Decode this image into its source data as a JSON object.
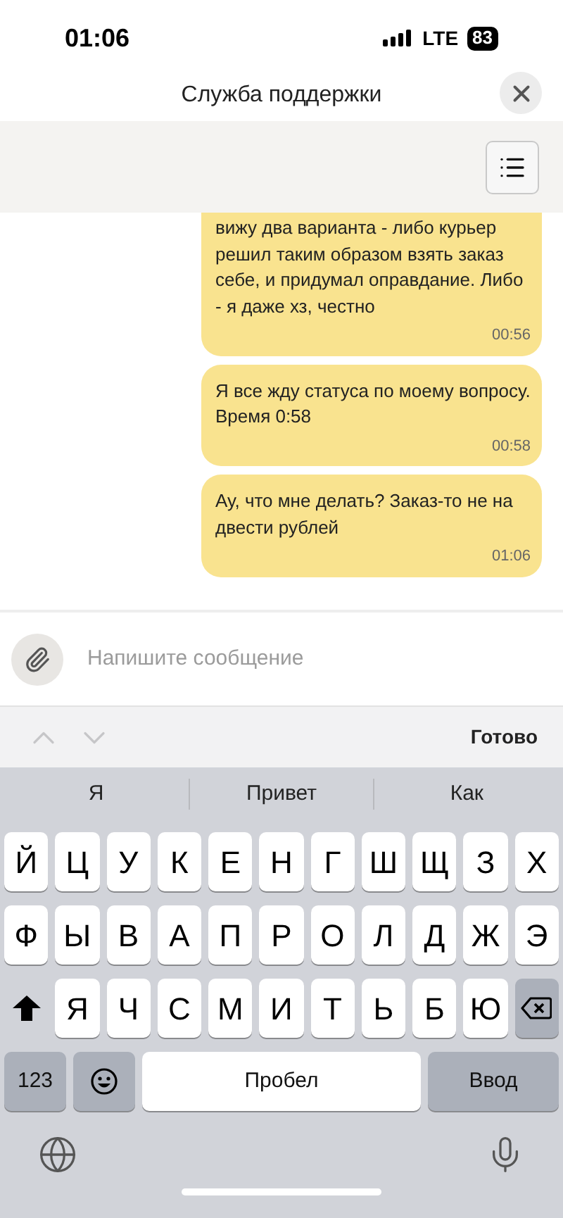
{
  "status_bar": {
    "time": "01:06",
    "network": "LTE",
    "battery": "83"
  },
  "header": {
    "title": "Служба поддержки"
  },
  "messages": [
    {
      "text": "вижу два варианта - либо курьер решил таким образом взять заказ себе, и придумал оправдание. Либо - я даже хз, честно",
      "time": "00:56",
      "cut_top": true
    },
    {
      "text": "Я все жду статуса по моему вопросу. Время 0:58",
      "time": "00:58",
      "cut_top": false
    },
    {
      "text": "Ау, что мне делать? Заказ-то не на двести рублей",
      "time": "01:06",
      "cut_top": false
    }
  ],
  "composer": {
    "placeholder": "Напишите сообщение"
  },
  "accessory_bar": {
    "done": "Готово"
  },
  "keyboard": {
    "suggestions": [
      "Я",
      "Привет",
      "Как"
    ],
    "rows": [
      {
        "keys": [
          "Й",
          "Ц",
          "У",
          "К",
          "Е",
          "Н",
          "Г",
          "Ш",
          "Щ",
          "З",
          "Х"
        ]
      },
      {
        "keys": [
          "Ф",
          "Ы",
          "В",
          "А",
          "П",
          "Р",
          "О",
          "Л",
          "Д",
          "Ж",
          "Э"
        ]
      },
      {
        "keys": [
          "Я",
          "Ч",
          "С",
          "М",
          "И",
          "Т",
          "Ь",
          "Б",
          "Ю"
        ]
      }
    ],
    "numbers_key": "123",
    "space_key": "Пробел",
    "return_key": "Ввод"
  }
}
